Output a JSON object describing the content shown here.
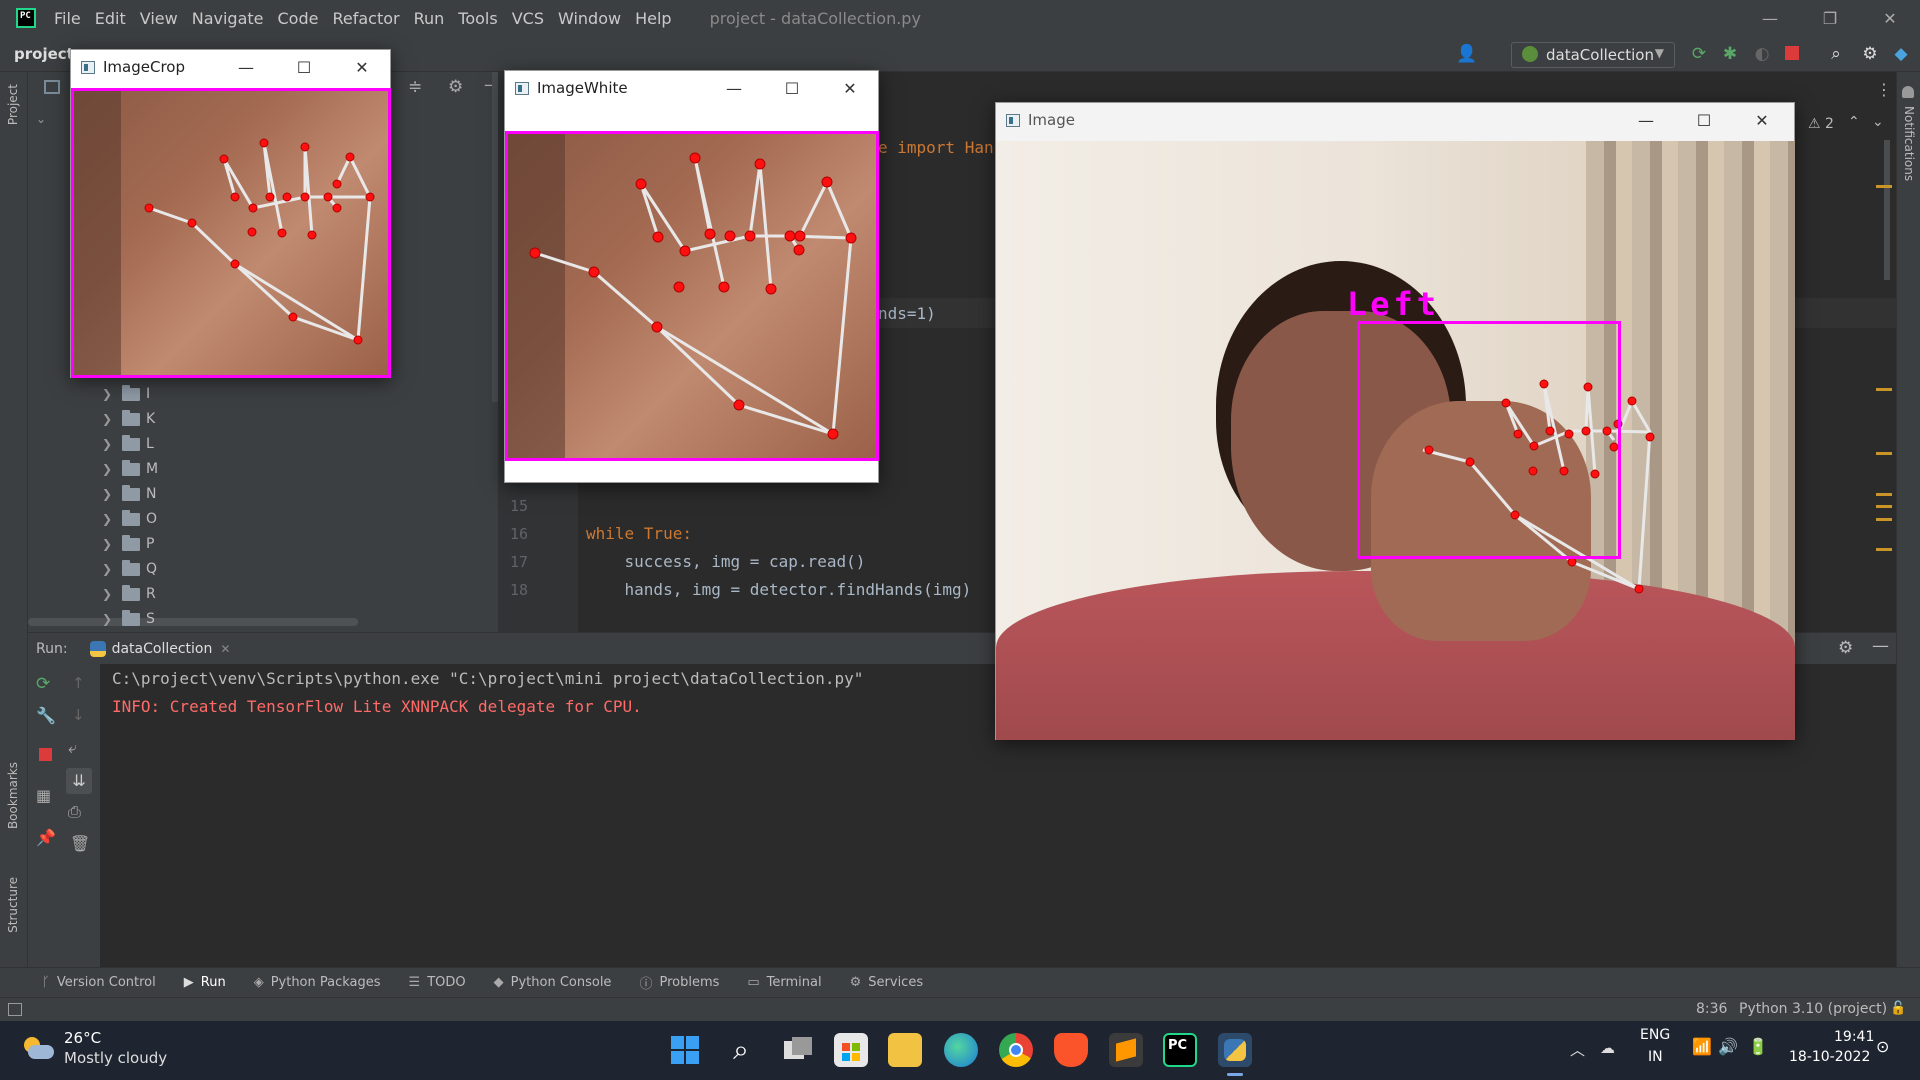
{
  "menubar": {
    "items": [
      "File",
      "Edit",
      "View",
      "Navigate",
      "Code",
      "Refactor",
      "Run",
      "Tools",
      "VCS",
      "Window",
      "Help"
    ],
    "title": "project - dataCollection.py"
  },
  "toolbar": {
    "project_label": "project",
    "run_config": "dataCollection"
  },
  "editor": {
    "warning_count": "2",
    "lines": [
      {
        "num": "15",
        "text": ""
      },
      {
        "num": "16",
        "text": "while True:"
      },
      {
        "num": "17",
        "text": "    success, img = cap.read()"
      },
      {
        "num": "18",
        "text": "    hands, img = detector.findHands(img)"
      }
    ],
    "fragment_import": "e import Han",
    "fragment_maxhands": "nds=1)"
  },
  "tree": {
    "folders": [
      "I",
      "K",
      "L",
      "M",
      "N",
      "O",
      "P",
      "Q",
      "R",
      "S"
    ]
  },
  "left_stripe": {
    "project": "Project",
    "bookmarks": "Bookmarks",
    "structure": "Structure"
  },
  "right_stripe": {
    "notifications": "Notifications"
  },
  "run_panel": {
    "label": "Run:",
    "tab": "dataCollection",
    "lines": [
      "C:\\project\\venv\\Scripts\\python.exe \"C:\\project\\mini project\\dataCollection.py\"",
      "INFO: Created TensorFlow Lite XNNPACK delegate for CPU."
    ]
  },
  "bottom_tools": [
    "Version Control",
    "Run",
    "Python Packages",
    "TODO",
    "Python Console",
    "Problems",
    "Terminal",
    "Services"
  ],
  "status": {
    "position": "8:36",
    "interpreter": "Python 3.10 (project)"
  },
  "windows": {
    "crop": "ImageCrop",
    "white": "ImageWhite",
    "image": "Image",
    "hand_label": "Left"
  },
  "taskbar": {
    "temp": "26°C",
    "weather": "Mostly cloudy",
    "lang1": "ENG",
    "lang2": "IN",
    "time": "19:41",
    "date": "18-10-2022"
  },
  "colors": {
    "accent": "#ff00ff",
    "landmark": "#ff1010",
    "error_text": "#ff6b68",
    "keyword": "#cc7832"
  }
}
